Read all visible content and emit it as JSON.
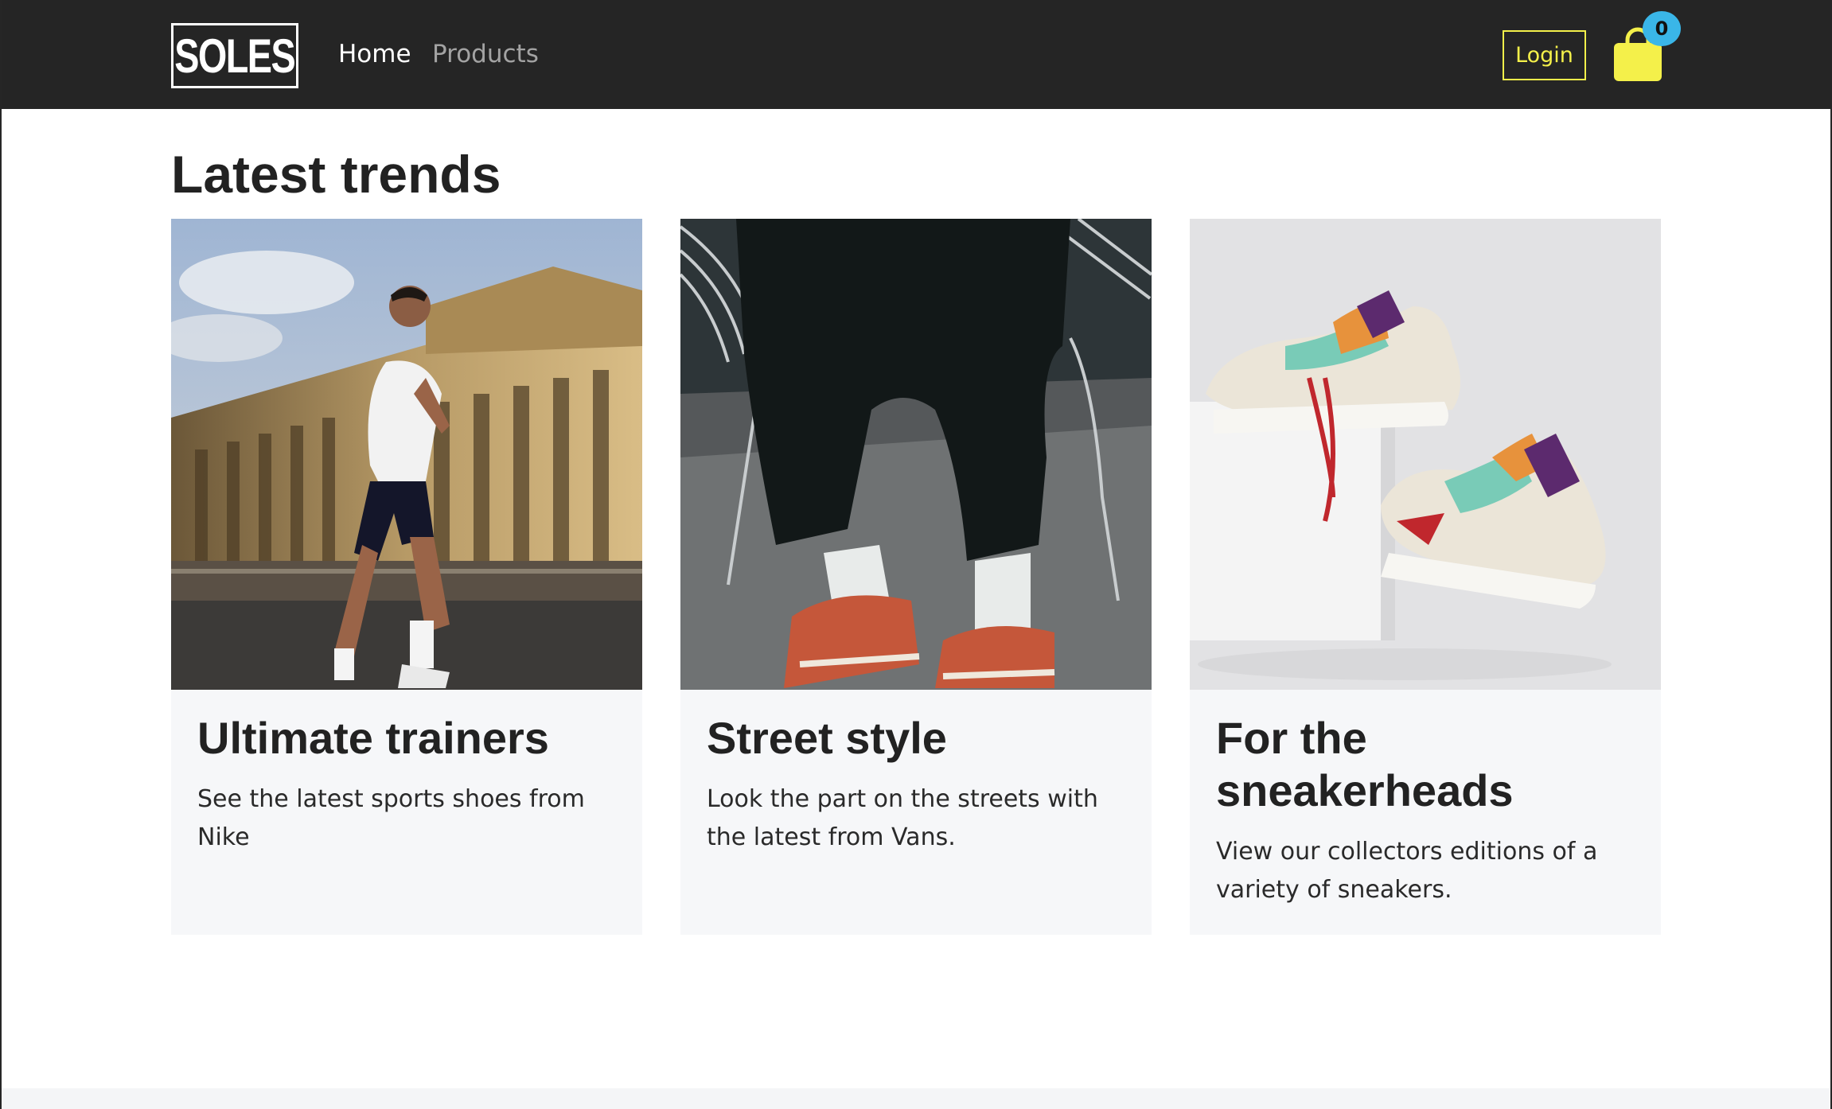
{
  "navbar": {
    "logo": "SOLES",
    "links": [
      {
        "label": "Home"
      },
      {
        "label": "Products"
      }
    ],
    "login_label": "Login",
    "cart_count": "0",
    "accent_color": "#f4f04a",
    "badge_color": "#3ab6e8"
  },
  "main": {
    "title": "Latest trends",
    "cards": [
      {
        "title": "Ultimate trainers",
        "text": "See the latest sports shoes from Nike",
        "image": "runner-photo"
      },
      {
        "title": "Street style",
        "text": "Look the part on the streets with the latest from Vans.",
        "image": "street-style-photo"
      },
      {
        "title": "For the sneakerheads",
        "text": "View our collectors editions of a variety of sneakers.",
        "image": "sneakers-photo"
      }
    ]
  }
}
